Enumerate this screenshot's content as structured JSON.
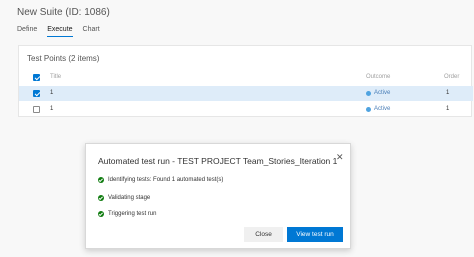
{
  "suite": {
    "title": "New Suite (ID: 1086)"
  },
  "tabs": [
    {
      "label": "Define"
    },
    {
      "label": "Execute"
    },
    {
      "label": "Chart"
    }
  ],
  "test_points": {
    "title": "Test Points (2 items)",
    "columns": {
      "title": "Title",
      "outcome": "Outcome",
      "order": "Order"
    },
    "rows": [
      {
        "title": "1",
        "outcome": "Active",
        "order": "1",
        "selected": true
      },
      {
        "title": "1",
        "outcome": "Active",
        "order": "1",
        "selected": false
      }
    ]
  },
  "dialog": {
    "title": "Automated test run - TEST PROJECT Team_Stories_Iteration 1",
    "steps": [
      {
        "text": "Identifying tests: Found 1 automated test(s)"
      },
      {
        "text": "Validating stage"
      },
      {
        "text": "Triggering test run"
      }
    ],
    "close_label": "Close",
    "view_label": "View test run"
  },
  "colors": {
    "accent": "#0078d4",
    "success": "#107c10",
    "active_dot": "#4fa3e0"
  }
}
